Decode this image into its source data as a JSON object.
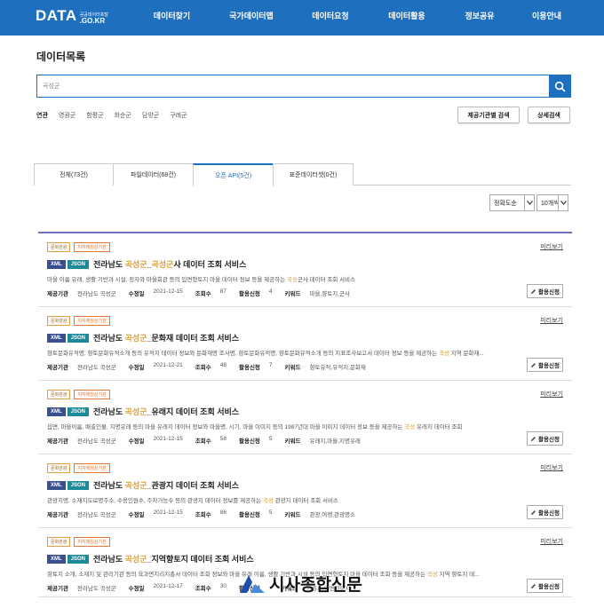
{
  "header": {
    "logo_text": "DATA",
    "logo_small": "공공데이터포털",
    "logo_domain": ".GO.KR",
    "nav": [
      "데이터찾기",
      "국가데이터맵",
      "데이터요청",
      "데이터활용",
      "정보공유",
      "이용안내"
    ]
  },
  "page_title": "데이터목록",
  "search": {
    "value": "곡성군",
    "icon": "search-icon"
  },
  "related": {
    "label": "연관",
    "items": [
      "영광군",
      "함평군",
      "화순군",
      "담양군",
      "구례군"
    ]
  },
  "buttons": {
    "org_search": "제공기관별 검색",
    "detail_search": "상세검색"
  },
  "tabs": [
    "전체(73건)",
    "파일데이터(68건)",
    "오픈 API(5건)",
    "표준데이터셋(0건)"
  ],
  "sort": {
    "order": "정확도순",
    "per_page": "10개씩"
  },
  "labels": {
    "preview": "미리보기",
    "apply": "활용신청",
    "org": "제공기관",
    "modified": "수정일",
    "views": "조회수",
    "applies": "활용신청",
    "keywords": "키워드",
    "badge_category": "문화관광",
    "badge_type": "지자체임상기관"
  },
  "items": [
    {
      "fmt": [
        "XML",
        "JSON"
      ],
      "title_pre": "전라남도 ",
      "title_hl": "곡성군",
      "title_mid": "_",
      "title_hl2": "곡성군",
      "title_post": "사 데이터 조회 서비스",
      "desc": "마을 이름 유래, 생활 기반과 시설, 정자와 마을회관 등의 입면형토지 마을 데이터 정보 등을 제공하는 곡성군사 데이터 조회 서비스",
      "org": "전라남도 곡성군",
      "date": "2021-12-15",
      "views": "87",
      "applies": "4",
      "keywords": "마을,향토지,군사"
    },
    {
      "fmt": [
        "XML",
        "JSON"
      ],
      "title_pre": "전라남도 ",
      "title_hl": "곡성군",
      "title_mid": "_문화재 데이터 조회 서비스",
      "title_hl2": "",
      "title_post": "",
      "desc": "향토문화유적명, 향토문화유적소개 등의 유적지 데이터 정보와 문화재명 조사명, 향토문화유적명, 향토문화유적소개 등의 지표조사보고서 데이터 정보 등을 제공하는 곡성 지역 문화재...",
      "org": "전라남도 곡성군",
      "date": "2021-12-21",
      "views": "48",
      "applies": "7",
      "keywords": "향토유적,유적지,문화재"
    },
    {
      "fmt": [
        "XML",
        "JSON"
      ],
      "title_pre": "전라남도 ",
      "title_hl": "곡성군",
      "title_mid": "_유래지 데이터 조회 서비스",
      "title_hl2": "",
      "title_post": "",
      "desc": "읍면, 마을이름, 배출인물, 지명유래 등의 마을 유래지 데이터 정보와 마을명, 시기, 마을 이미지 등의 1987년대 마을 이미지 데이터 정보 등을 제공하는 곡성 유래지 데이터 조회",
      "org": "전라남도 곡성군",
      "date": "2021-12-15",
      "views": "58",
      "applies": "5",
      "keywords": "유래지,마을,지명유래"
    },
    {
      "fmt": [
        "XML",
        "JSON"
      ],
      "title_pre": "전라남도 ",
      "title_hl": "곡성군",
      "title_mid": "_관광지 데이터 조회 서비스",
      "title_hl2": "",
      "title_post": "",
      "desc": "관광지명, 소재지도로명주소, 수용인원수, 주차가능수 등의 관광지 데이터 정보를 제공하는 곡성 관광지 데이터 조회 서비스",
      "org": "전라남도 곡성군",
      "date": "2021-12-15",
      "views": "86",
      "applies": "5",
      "keywords": "관광,여행,관광명소"
    },
    {
      "fmt": [
        "XML",
        "JSON"
      ],
      "title_pre": "전라남도 ",
      "title_hl": "곡성군",
      "title_mid": "_지역향토지 데이터 조회 서비스",
      "title_hl2": "",
      "title_post": "",
      "desc": "향토지 소개, 소재지 및 관리기관 등의 육과면지리지총서 데이터 조회 정보와 마을 유래 이름, 생활 기반과 시설 등의 입면형토지 마을 데이터 조회 등을 제공하는 곡성 지역 향토지 데...",
      "org": "전라남도 곡성군",
      "date": "2021-12-17",
      "views": "30",
      "applies": "",
      "keywords": "지총서,입면향토지"
    }
  ],
  "watermark": "시사종합신문"
}
